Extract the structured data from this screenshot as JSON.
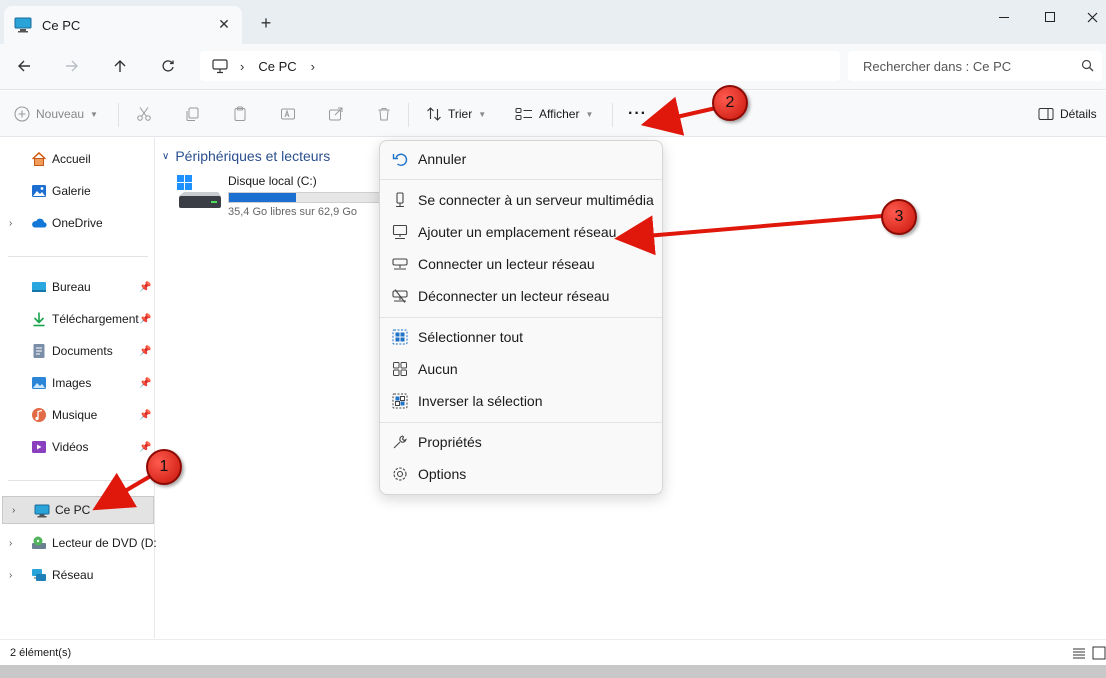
{
  "window": {
    "tab_title": "Ce PC",
    "tab_close": "✕",
    "new_tab": "+"
  },
  "address": {
    "location": "Ce PC",
    "search_placeholder": "Rechercher dans : Ce PC"
  },
  "commandbar": {
    "new_label": "Nouveau",
    "sort_label": "Trier",
    "view_label": "Afficher",
    "more_label": "···",
    "details_label": "Détails"
  },
  "sidebar": {
    "quick": [
      {
        "label": "Accueil"
      },
      {
        "label": "Galerie"
      },
      {
        "label": "OneDrive"
      }
    ],
    "pinned": [
      {
        "label": "Bureau"
      },
      {
        "label": "Téléchargement"
      },
      {
        "label": "Documents"
      },
      {
        "label": "Images"
      },
      {
        "label": "Musique"
      },
      {
        "label": "Vidéos"
      }
    ],
    "devices": [
      {
        "label": "Ce PC"
      },
      {
        "label": "Lecteur de DVD (D:"
      },
      {
        "label": "Réseau"
      }
    ]
  },
  "content": {
    "group_title": "Périphériques et lecteurs",
    "drive": {
      "name": "Disque local (C:)",
      "free_text": "35,4 Go libres sur 62,9 Go",
      "used_fraction": 0.437
    }
  },
  "menu": {
    "items": [
      {
        "label": "Annuler"
      },
      {
        "label": "Se connecter à un serveur multimédia"
      },
      {
        "label": "Ajouter un emplacement réseau"
      },
      {
        "label": "Connecter un lecteur réseau"
      },
      {
        "label": "Déconnecter un lecteur réseau"
      },
      {
        "label": "Sélectionner tout"
      },
      {
        "label": "Aucun"
      },
      {
        "label": "Inverser la sélection"
      },
      {
        "label": "Propriétés"
      },
      {
        "label": "Options"
      }
    ]
  },
  "status": {
    "count": "2 élément(s)"
  },
  "annotations": {
    "one": "1",
    "two": "2",
    "three": "3"
  },
  "colors": {
    "accent": "#1a6fd0",
    "annotation_red": "#e0170b"
  }
}
